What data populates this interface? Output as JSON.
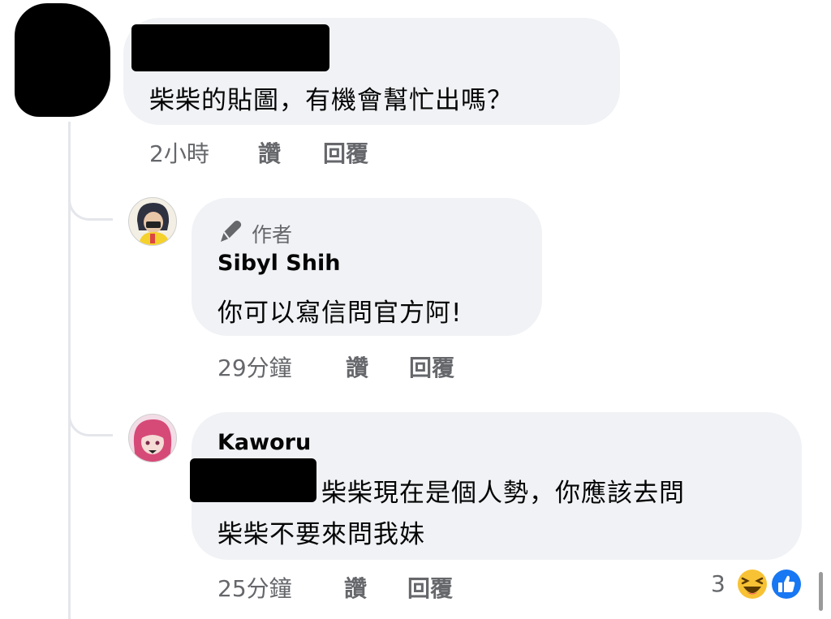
{
  "comments": [
    {
      "text": "柴柴的貼圖，有機會幫忙出嗎？",
      "time": "2小時",
      "like_label": "讚",
      "reply_label": "回覆"
    },
    {
      "badge": "作者",
      "author": "Sibyl Shih",
      "text": "你可以寫信問官方阿!",
      "time": "29分鐘",
      "like_label": "讚",
      "reply_label": "回覆"
    },
    {
      "author": "Kaworu",
      "text_line1": "柴柴現在是個人勢，你應該去問",
      "text_line2": "柴柴不要來問我妹",
      "time": "25分鐘",
      "like_label": "讚",
      "reply_label": "回覆",
      "reaction_count": "3",
      "reactions": [
        "haha-emoji",
        "like-emoji"
      ]
    }
  ],
  "colors": {
    "bubble": "#f0f2f5",
    "secondary_text": "#65676b",
    "like_blue": "#1877f2",
    "haha_yellow": "#f7c234"
  }
}
